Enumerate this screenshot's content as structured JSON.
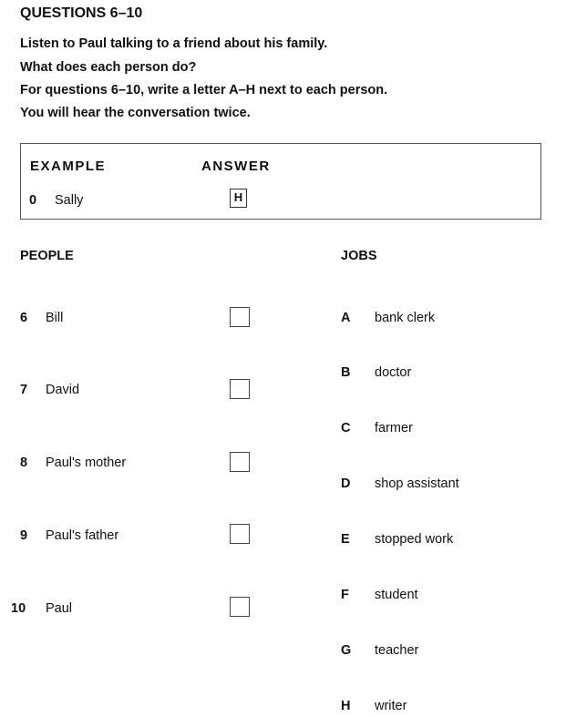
{
  "title": "QUESTIONS 6–10",
  "instructions": [
    "Listen to Paul talking to a friend about his family.",
    "What does each person do?",
    "For questions 6–10, write a letter A–H next to each person.",
    "You will hear the conversation twice."
  ],
  "example": {
    "heading": "EXAMPLE",
    "answer_heading": "ANSWER",
    "number": "0",
    "name": "Sally",
    "answer": "H"
  },
  "people_heading": "PEOPLE",
  "jobs_heading": "JOBS",
  "people": [
    {
      "number": "6",
      "name": "Bill",
      "answer": ""
    },
    {
      "number": "7",
      "name": "David",
      "answer": ""
    },
    {
      "number": "8",
      "name": "Paul's mother",
      "answer": ""
    },
    {
      "number": "9",
      "name": "Paul's father",
      "answer": ""
    },
    {
      "number": "10",
      "name": "Paul",
      "answer": ""
    }
  ],
  "jobs": [
    {
      "letter": "A",
      "text": "bank clerk"
    },
    {
      "letter": "B",
      "text": "doctor"
    },
    {
      "letter": "C",
      "text": "farmer"
    },
    {
      "letter": "D",
      "text": "shop assistant"
    },
    {
      "letter": "E",
      "text": "stopped work"
    },
    {
      "letter": "F",
      "text": "student"
    },
    {
      "letter": "G",
      "text": "teacher"
    },
    {
      "letter": "H",
      "text": "writer"
    }
  ]
}
